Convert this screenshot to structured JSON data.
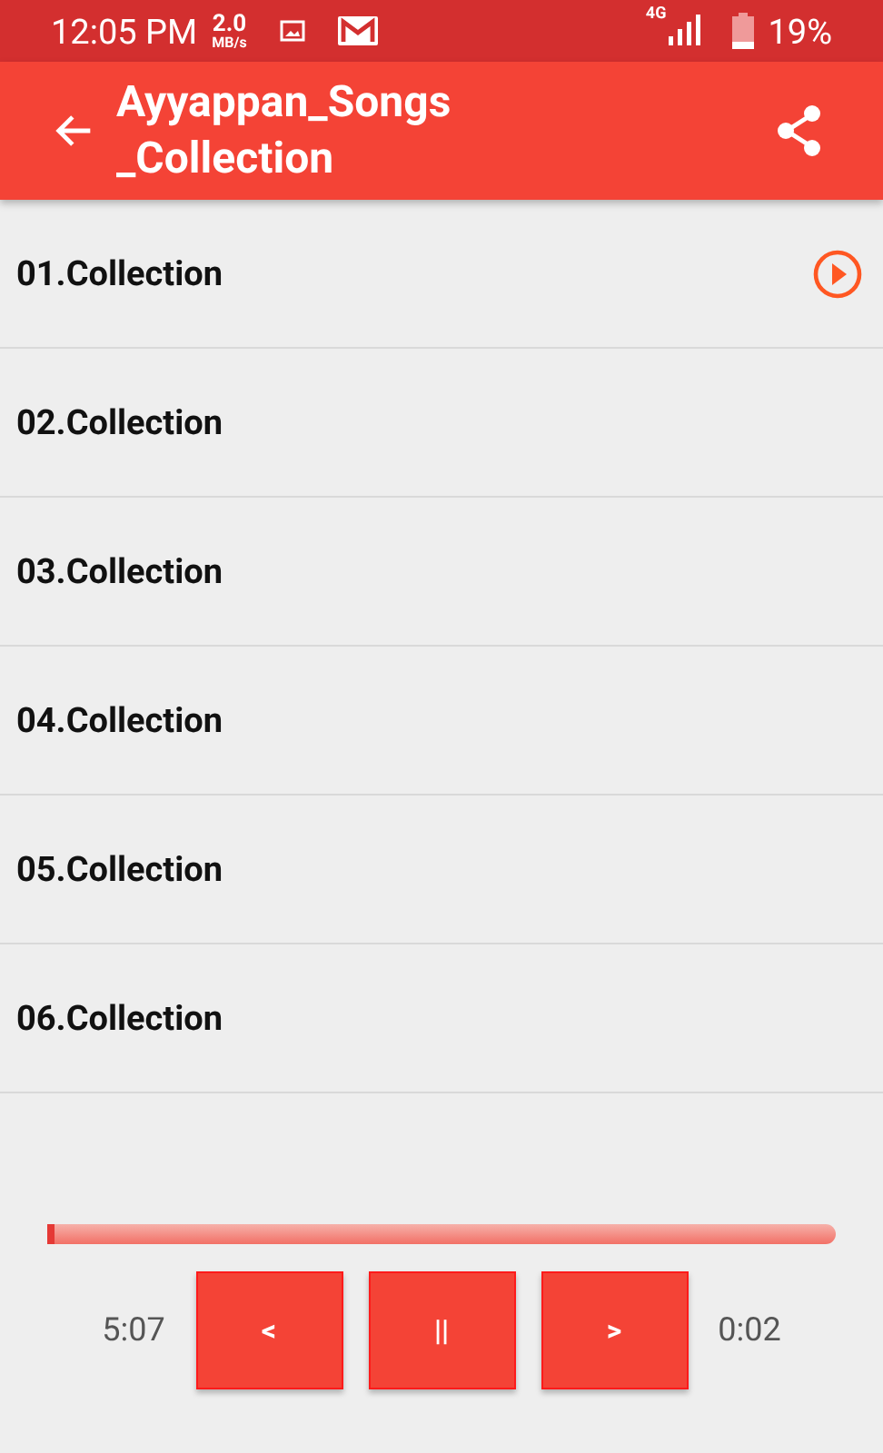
{
  "status_bar": {
    "time": "12:05 PM",
    "speed_value": "2.0",
    "speed_unit": "MB/s",
    "network": "4G",
    "battery": "19%"
  },
  "app_bar": {
    "title": "Ayyappan_Songs\n_Collection"
  },
  "songs": [
    {
      "title": "01.Collection",
      "playing": true
    },
    {
      "title": "02.Collection",
      "playing": false
    },
    {
      "title": "03.Collection",
      "playing": false
    },
    {
      "title": "04.Collection",
      "playing": false
    },
    {
      "title": "05.Collection",
      "playing": false
    },
    {
      "title": "06.Collection",
      "playing": false
    }
  ],
  "player": {
    "level": 0.01,
    "total": "5:07",
    "elapsed": "0:02",
    "buttons": [
      "<",
      "||",
      ">"
    ]
  }
}
